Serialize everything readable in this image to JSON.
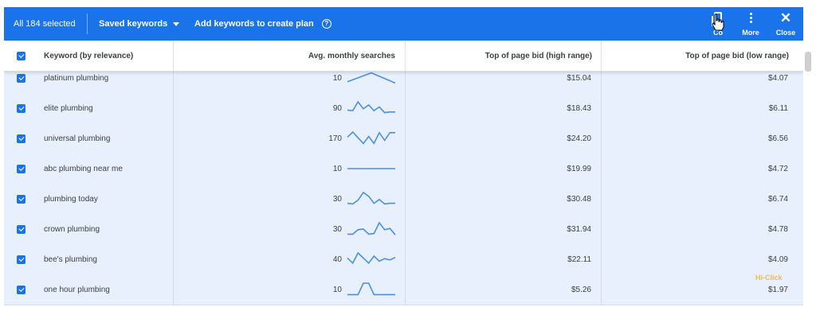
{
  "toolbar": {
    "selected_label": "All 184 selected",
    "saved_keywords_label": "Saved keywords",
    "add_keywords_label": "Add keywords to create plan",
    "help_icon": "question-circle-icon",
    "actions": {
      "copy_label": "Co",
      "more_label": "More",
      "close_label": "Close"
    }
  },
  "table": {
    "columns": {
      "keyword": "Keyword (by relevance)",
      "searches": "Avg. monthly searches",
      "bid_high": "Top of page bid (high range)",
      "bid_low": "Top of page bid (low range)"
    },
    "rows": [
      {
        "keyword": "platinum plumbing",
        "searches": "10",
        "bid_high": "$15.04",
        "bid_low": "$4.07",
        "trend": [
          0.2,
          0.9,
          0.1
        ]
      },
      {
        "keyword": "elite plumbing",
        "searches": "90",
        "bid_high": "$18.43",
        "bid_low": "$6.11",
        "trend": [
          0.35,
          0.3,
          1.0,
          0.45,
          0.75,
          0.3,
          0.6,
          0.15,
          0.2,
          0.2
        ]
      },
      {
        "keyword": "universal plumbing",
        "searches": "170",
        "bid_high": "$24.20",
        "bid_low": "$6.56",
        "trend": [
          0.6,
          1.0,
          0.55,
          0.1,
          0.65,
          0.1,
          0.95,
          0.35,
          0.95,
          0.95
        ]
      },
      {
        "keyword": "abc plumbing near me",
        "searches": "10",
        "bid_high": "$19.99",
        "bid_low": "$4.72",
        "trend": [
          0.5,
          0.5,
          0.5,
          0.5,
          0.5,
          0.5,
          0.5,
          0.5,
          0.5,
          0.5
        ]
      },
      {
        "keyword": "plumbing today",
        "searches": "30",
        "bid_high": "$30.48",
        "bid_low": "$6.74",
        "trend": [
          0.15,
          0.1,
          0.4,
          1.0,
          0.7,
          0.15,
          0.45,
          0.1,
          0.15,
          0.15
        ]
      },
      {
        "keyword": "crown plumbing",
        "searches": "30",
        "bid_high": "$31.94",
        "bid_low": "$4.78",
        "trend": [
          0.1,
          0.1,
          0.45,
          0.5,
          0.1,
          0.15,
          1.0,
          0.45,
          0.55,
          0.05
        ]
      },
      {
        "keyword": "bee's plumbing",
        "searches": "40",
        "bid_high": "$22.11",
        "bid_low": "$4.09",
        "trend": [
          0.6,
          0.2,
          1.0,
          0.6,
          0.2,
          0.75,
          0.35,
          0.55,
          0.45,
          0.65
        ]
      },
      {
        "keyword": "one hour plumbing",
        "searches": "10",
        "bid_high": "$5.26",
        "bid_low": "$1.97",
        "trend": [
          0.1,
          0.1,
          0.1,
          1.0,
          1.0,
          0.1,
          0.1,
          0.1,
          0.1,
          0.1
        ]
      }
    ]
  },
  "watermark": "Hi-Click",
  "colors": {
    "toolbar": "#1a73e8",
    "row_selected": "#e8f0fe",
    "spark": "#4a90e2"
  }
}
